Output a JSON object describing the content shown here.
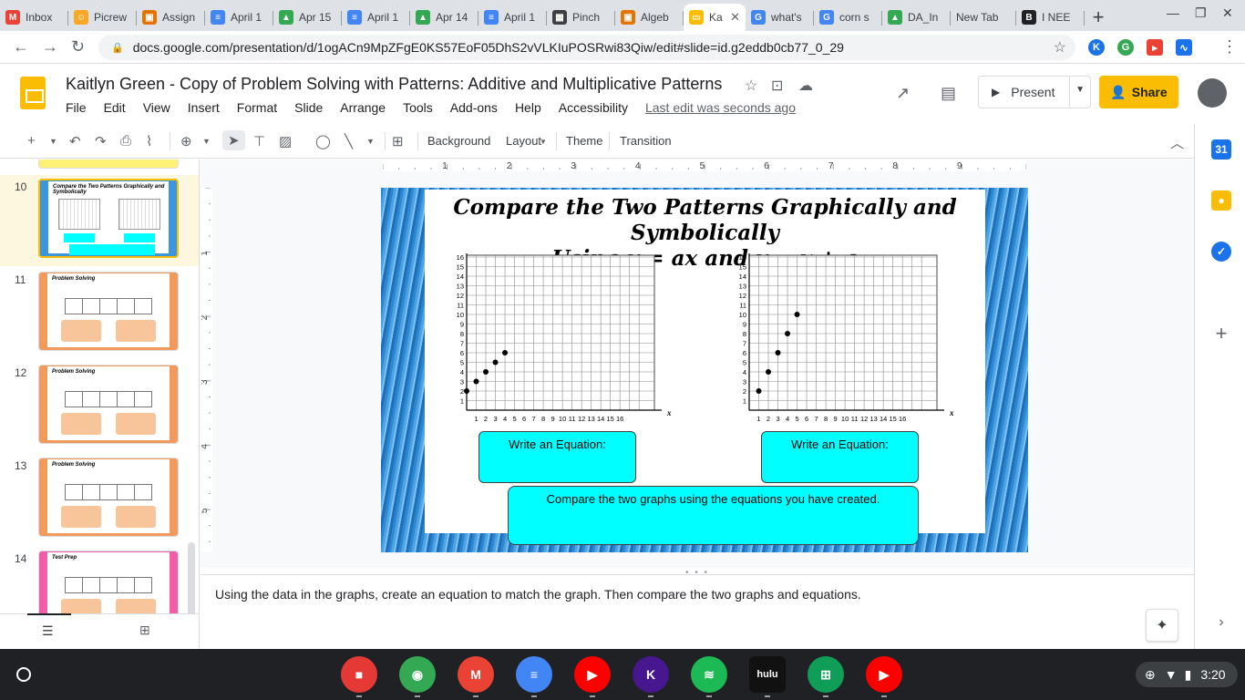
{
  "browser": {
    "tabs": [
      {
        "label": "Inbox",
        "fav_color": "#ea4335",
        "fav_glyph": "M"
      },
      {
        "label": "Picrew",
        "fav_color": "#f9a825",
        "fav_glyph": "☺"
      },
      {
        "label": "Assign",
        "fav_color": "#e37400",
        "fav_glyph": "▣"
      },
      {
        "label": "April 1",
        "fav_color": "#4285f4",
        "fav_glyph": "≡"
      },
      {
        "label": "Apr 15",
        "fav_color": "#34a853",
        "fav_glyph": "▲"
      },
      {
        "label": "April 1",
        "fav_color": "#4285f4",
        "fav_glyph": "≡"
      },
      {
        "label": "Apr 14",
        "fav_color": "#34a853",
        "fav_glyph": "▲"
      },
      {
        "label": "April 1",
        "fav_color": "#4285f4",
        "fav_glyph": "≡"
      },
      {
        "label": "Pinch",
        "fav_color": "#3c4043",
        "fav_glyph": "▦"
      },
      {
        "label": "Algeb",
        "fav_color": "#e37400",
        "fav_glyph": "▣"
      },
      {
        "label": "Ka",
        "fav_color": "#fbbc04",
        "fav_glyph": "▭",
        "active": true
      },
      {
        "label": "what's",
        "fav_color": "#4285f4",
        "fav_glyph": "G"
      },
      {
        "label": "corn s",
        "fav_color": "#4285f4",
        "fav_glyph": "G"
      },
      {
        "label": "DA_In",
        "fav_color": "#34a853",
        "fav_glyph": "▲"
      },
      {
        "label": "New Tab",
        "fav_color": "",
        "fav_glyph": ""
      },
      {
        "label": "I NEE",
        "fav_color": "#202124",
        "fav_glyph": "B"
      }
    ],
    "url": "docs.google.com/presentation/d/1ogACn9MpZFgE0KS57EoF05DhS2vVLKIuPOSRwi83Qiw/edit#slide=id.g2eddb0cb77_0_29"
  },
  "doc": {
    "title": "Kaitlyn Green - Copy of Problem Solving with Patterns: Additive and Multiplicative Patterns",
    "menu": [
      "File",
      "Edit",
      "View",
      "Insert",
      "Format",
      "Slide",
      "Arrange",
      "Tools",
      "Add-ons",
      "Help",
      "Accessibility"
    ],
    "last_edit": "Last edit was seconds ago",
    "present_label": "Present",
    "share_label": "Share"
  },
  "toolbar": {
    "background_label": "Background",
    "layout_label": "Layout",
    "theme_label": "Theme",
    "transition_label": "Transition"
  },
  "filmstrip": {
    "slides": [
      {
        "num": "10",
        "title": "Compare the Two Patterns Graphically and Symbolically",
        "theme": "blue",
        "selected": true
      },
      {
        "num": "11",
        "title": "Problem Solving",
        "theme": "orange"
      },
      {
        "num": "12",
        "title": "Problem Solving",
        "theme": "orange"
      },
      {
        "num": "13",
        "title": "Problem Solving",
        "theme": "orange"
      },
      {
        "num": "14",
        "title": "Test Prep",
        "theme": "pink"
      }
    ]
  },
  "ruler": {
    "h_ticks": [
      "1",
      "2",
      "3",
      "4",
      "5",
      "6",
      "7",
      "8",
      "9"
    ],
    "v_ticks": [
      "1",
      "2",
      "3",
      "4",
      "5"
    ]
  },
  "slide": {
    "title_line1": "Compare the Two Patterns Graphically and Symbolically",
    "title_line2": "Using y = ax and y = x + a",
    "eq_box_left": "Write an Equation:",
    "eq_box_right": "Write an Equation:",
    "compare_box": "Compare the two graphs using the equations you have created.",
    "graphs": [
      {
        "x_label": "x",
        "y_label": "y",
        "x_ticks": [
          1,
          2,
          3,
          4,
          5,
          6,
          7,
          8,
          9,
          10,
          11,
          12,
          13,
          14,
          15,
          16
        ],
        "y_ticks": [
          1,
          2,
          3,
          4,
          5,
          6,
          7,
          8,
          9,
          10,
          11,
          12,
          13,
          14,
          15,
          16
        ],
        "points": [
          [
            0,
            2
          ],
          [
            1,
            3
          ],
          [
            2,
            4
          ],
          [
            3,
            5
          ],
          [
            4,
            6
          ]
        ]
      },
      {
        "x_label": "x",
        "y_label": "y",
        "x_ticks": [
          1,
          2,
          3,
          4,
          5,
          6,
          7,
          8,
          9,
          10,
          11,
          12,
          13,
          14,
          15,
          16
        ],
        "y_ticks": [
          1,
          2,
          3,
          4,
          5,
          6,
          7,
          8,
          9,
          10,
          11,
          12,
          13,
          14,
          15,
          16
        ],
        "points": [
          [
            1,
            2
          ],
          [
            2,
            4
          ],
          [
            3,
            6
          ],
          [
            4,
            8
          ],
          [
            5,
            10
          ]
        ]
      }
    ]
  },
  "notes": {
    "text": "Using the data in the graphs, create an equation to match the graph.  Then compare the two graphs and equations."
  },
  "shelf": {
    "time": "3:20",
    "apps": [
      {
        "name": "screencastify",
        "color": "#e53935",
        "glyph": "■"
      },
      {
        "name": "chrome",
        "color": "#34a853",
        "glyph": "◉"
      },
      {
        "name": "gmail",
        "color": "#ea4335",
        "glyph": "M"
      },
      {
        "name": "docs",
        "color": "#4285f4",
        "glyph": "≡"
      },
      {
        "name": "youtube",
        "color": "#ff0000",
        "glyph": "▶"
      },
      {
        "name": "kahoot",
        "color": "#46178f",
        "glyph": "K"
      },
      {
        "name": "spotify",
        "color": "#1db954",
        "glyph": "≋"
      },
      {
        "name": "hulu",
        "color": "#111111",
        "glyph": "hulu"
      },
      {
        "name": "sheets",
        "color": "#0f9d58",
        "glyph": "⊞"
      },
      {
        "name": "youtube-music",
        "color": "#ff0000",
        "glyph": "▶"
      }
    ]
  }
}
